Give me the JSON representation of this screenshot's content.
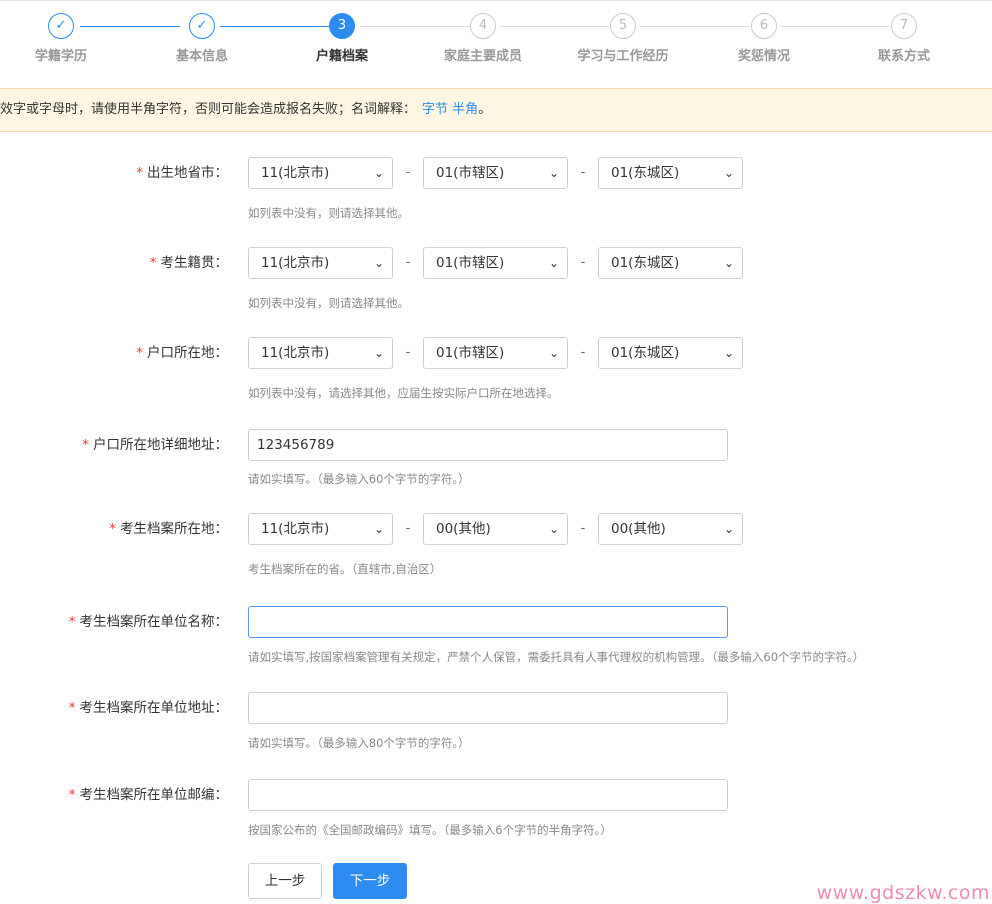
{
  "steps": [
    {
      "num": "✓",
      "label": "学籍学历",
      "state": "done"
    },
    {
      "num": "✓",
      "label": "基本信息",
      "state": "done"
    },
    {
      "num": "3",
      "label": "户籍档案",
      "state": "active"
    },
    {
      "num": "4",
      "label": "家庭主要成员",
      "state": "todo"
    },
    {
      "num": "5",
      "label": "学习与工作经历",
      "state": "todo"
    },
    {
      "num": "6",
      "label": "奖惩情况",
      "state": "todo"
    },
    {
      "num": "7",
      "label": "联系方式",
      "state": "todo"
    }
  ],
  "notice": {
    "text": "效字或字母时，请使用半角字符，否则可能会造成报名失败；名词解释：",
    "link1": "字节",
    "link2": "半角",
    "end": "。"
  },
  "form": {
    "birthplace": {
      "label": "出生地省市：",
      "sel1": "11(北京市)",
      "sel2": "01(市辖区)",
      "sel3": "01(东城区)",
      "hint": "如列表中没有，则请选择其他。"
    },
    "native": {
      "label": "考生籍贯：",
      "sel1": "11(北京市)",
      "sel2": "01(市辖区)",
      "sel3": "01(东城区)",
      "hint": "如列表中没有，则请选择其他。"
    },
    "hukou": {
      "label": "户口所在地：",
      "sel1": "11(北京市)",
      "sel2": "01(市辖区)",
      "sel3": "01(东城区)",
      "hint": "如列表中没有，请选择其他，应届生按实际户口所在地选择。"
    },
    "hukou_addr": {
      "label": "户口所在地详细地址：",
      "value": "123456789",
      "hint": "请如实填写。（最多输入60个字节的字符。）"
    },
    "archive_loc": {
      "label": "考生档案所在地：",
      "sel1": "11(北京市)",
      "sel2": "00(其他)",
      "sel3": "00(其他)",
      "hint": "考生档案所在的省。（直辖市,自治区）"
    },
    "archive_unit": {
      "label": "考生档案所在单位名称：",
      "value": "",
      "hint": "请如实填写,按国家档案管理有关规定，严禁个人保管，需委托具有人事代理权的机构管理。（最多输入60个字节的字符。）"
    },
    "archive_unit_addr": {
      "label": "考生档案所在单位地址：",
      "value": "",
      "hint": "请如实填写。（最多输入80个字节的字符。）"
    },
    "archive_unit_zip": {
      "label": "考生档案所在单位邮编：",
      "value": "",
      "hint": "按国家公布的《全国邮政编码》填写。（最多输入6个字节的半角字符。）"
    }
  },
  "buttons": {
    "prev": "上一步",
    "next": "下一步"
  },
  "dash": "-",
  "required_mark": "*",
  "chevron": "⌄",
  "watermark": "www.gdszkw.com",
  "colors": {
    "primary": "#2d8cf0",
    "required": "#e4393c",
    "notice_bg": "#fdf6e3"
  }
}
